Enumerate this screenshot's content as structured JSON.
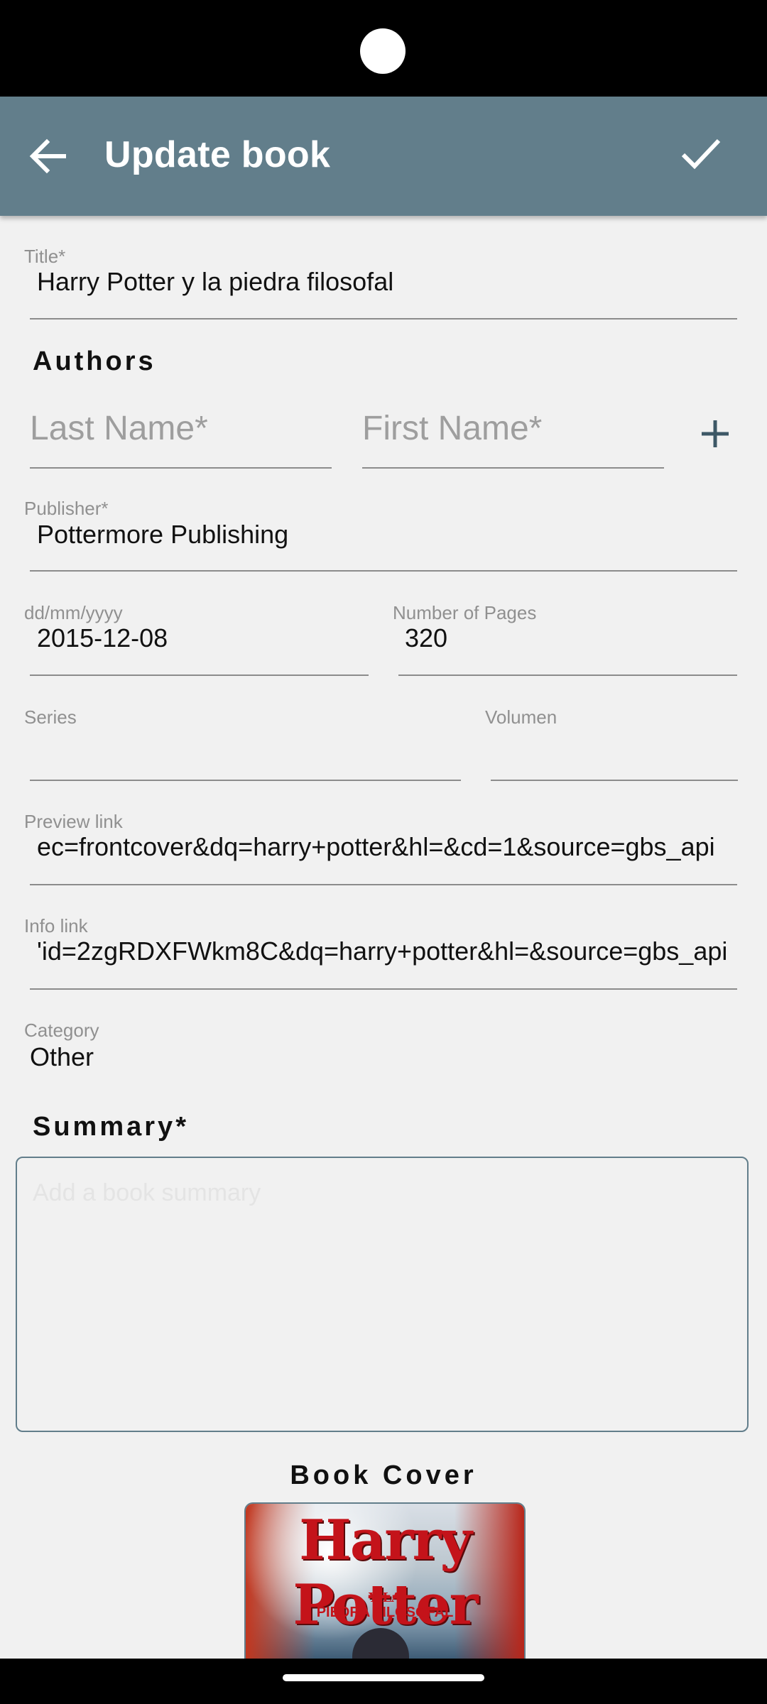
{
  "header": {
    "title": "Update book"
  },
  "form": {
    "title": {
      "label": "Title*",
      "value": "Harry Potter y la piedra filosofal"
    },
    "authors": {
      "section_label": "Authors",
      "last_name_placeholder": "Last Name*",
      "first_name_placeholder": "First Name*"
    },
    "publisher": {
      "label": "Publisher*",
      "value": "Pottermore Publishing"
    },
    "date": {
      "label": "dd/mm/yyyy",
      "value": "2015-12-08"
    },
    "pages": {
      "label": "Number of Pages",
      "value": "320"
    },
    "series": {
      "label": "Series",
      "value": ""
    },
    "volume": {
      "label": "Volumen",
      "value": ""
    },
    "preview_link": {
      "label": "Preview link",
      "value": "ec=frontcover&dq=harry+potter&hl=&cd=1&source=gbs_api"
    },
    "info_link": {
      "label": "Info link",
      "value": "'id=2zgRDXFWkm8C&dq=harry+potter&hl=&source=gbs_api"
    },
    "category": {
      "label": "Category",
      "value": "Other"
    },
    "summary": {
      "section_label": "Summary*",
      "placeholder": "Add a book summary"
    },
    "cover": {
      "section_label": "Book Cover",
      "image_title": "Harry Potter",
      "image_line1": "Y LA",
      "image_line2": "PIEDRA FILOSOFAL"
    }
  },
  "icons": {
    "back": "arrow-left-icon",
    "save": "checkmark-icon",
    "add_author": "plus-icon"
  },
  "colors": {
    "appbar": "#627e8b",
    "background": "#f1f1f1",
    "underline": "#8c8c8c"
  }
}
